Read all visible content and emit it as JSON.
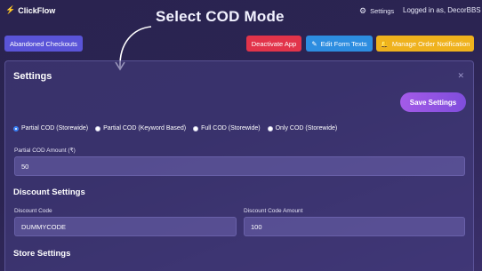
{
  "app": {
    "brand": "ClickFlow",
    "headline": "Select COD Mode"
  },
  "header": {
    "settings_label": "Settings",
    "logged_in": "Logged in as, DecorBBS"
  },
  "toolbar": {
    "abandoned": "Abandoned Checkouts",
    "deactivate": "Deactivate App",
    "edit_form": "Edit Form Texts",
    "notify": "Manage Order Notification"
  },
  "panel": {
    "title": "Settings",
    "save": "Save Settings",
    "cod_modes": [
      {
        "label": "Partial COD (Storewide)",
        "checked": true
      },
      {
        "label": "Partial COD (Keyword Based)",
        "checked": false
      },
      {
        "label": "Full COD (Storewide)",
        "checked": false
      },
      {
        "label": "Only COD (Storewide)",
        "checked": false
      }
    ],
    "partial_amount_label": "Partial COD Amount (₹)",
    "partial_amount_value": "50",
    "discount_section": "Discount Settings",
    "discount_code_label": "Discount Code",
    "discount_code_value": "DUMMYCODE",
    "discount_amount_label": "Discount Code Amount",
    "discount_amount_value": "100",
    "store_section": "Store Settings"
  },
  "colors": {
    "accent": "#5a54d8",
    "danger": "#e2344a",
    "info": "#2d8de0",
    "warning": "#efb21d",
    "save_gradient_start": "#a45be8"
  }
}
